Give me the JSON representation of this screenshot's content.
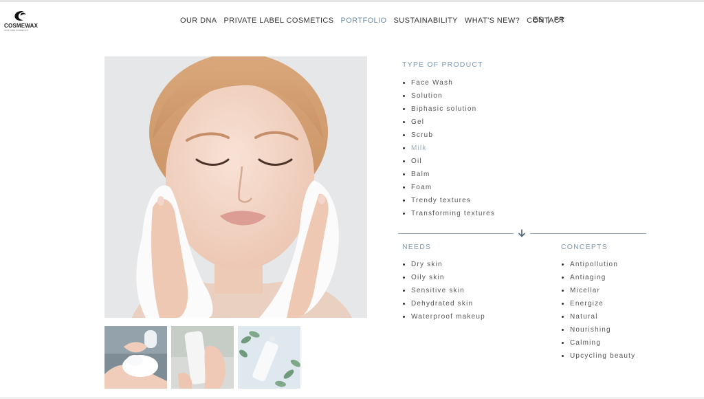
{
  "brand": {
    "name": "COSMEWAX",
    "tagline": "SKIN CARE COSMETICS"
  },
  "nav": {
    "items": [
      "OUR DNA",
      "PRIVATE LABEL COSMETICS",
      "PORTFOLIO",
      "SUSTAINABILITY",
      "WHAT'S NEW?",
      "CONTACT"
    ],
    "active": "PORTFOLIO"
  },
  "lang": {
    "es": "ES",
    "sep": "|",
    "fr": "FR"
  },
  "type_of_product": {
    "title": "TYPE OF PRODUCT",
    "items": [
      "Face Wash",
      "Solution",
      "Biphasic solution",
      "Gel",
      "Scrub",
      "Milk",
      "Oil",
      "Balm",
      "Foam",
      "Trendy textures",
      "Transforming textures"
    ]
  },
  "needs": {
    "title": "NEEDS",
    "items": [
      "Dry skin",
      "Oily skin",
      "Sensitive skin",
      "Dehydrated skin",
      "Waterproof makeup"
    ]
  },
  "concepts": {
    "title": "CONCEPTS",
    "items": [
      "Antipollution",
      "Antiaging",
      "Micellar",
      "Energize",
      "Natural",
      "Nourishing",
      "Calming",
      "Upcycling beauty"
    ]
  },
  "colors": {
    "accent": "#7f97ab",
    "text": "#555555",
    "divider": "#9aa8b4"
  },
  "icons": {
    "scroll": "arrow-down-icon"
  }
}
